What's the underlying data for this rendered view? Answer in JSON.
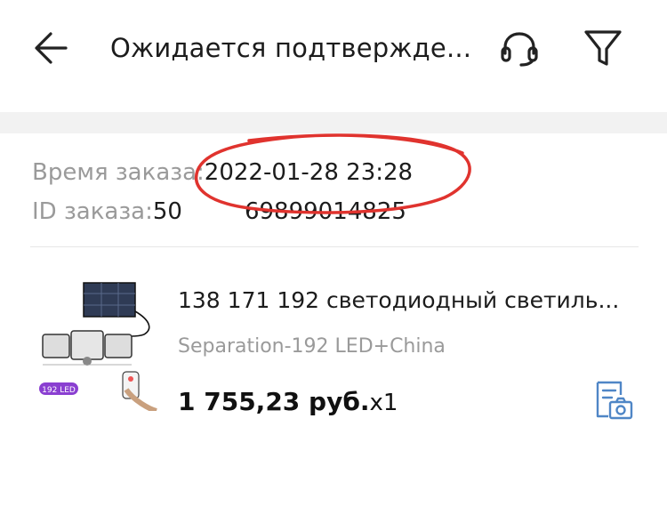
{
  "header": {
    "title": "Ожидается подтвержде...",
    "back_icon": "arrow-left-icon",
    "support_icon": "headset-icon",
    "filter_icon": "funnel-icon"
  },
  "order": {
    "time_label": "Время заказа:",
    "time_value": "2022-01-28 23:28",
    "id_label": "ID заказа:",
    "id_prefix": "50",
    "id_suffix": "69899014825"
  },
  "product": {
    "name": "138 171 192 светодиодный светиль...",
    "variant": "Separation-192 LED+China",
    "price": "1 755,23 руб.",
    "quantity": "x1",
    "badge": "192 LED",
    "photo_action_icon": "photo-review-icon"
  },
  "colors": {
    "annotation": "#e0332e",
    "accent_blue": "#4f86c6",
    "badge": "#8a3fd1"
  }
}
